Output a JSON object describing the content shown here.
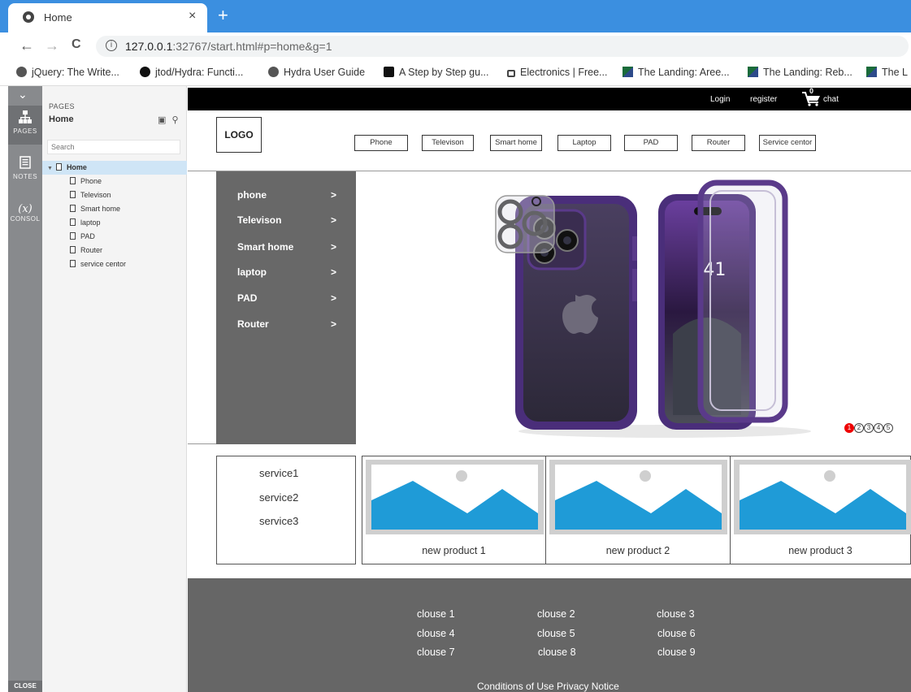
{
  "browser": {
    "tab_title": "Home",
    "tab_close": "×",
    "new_tab": "+",
    "back": "←",
    "forward": "→",
    "reload": "C",
    "url_host": "127.0.0.1",
    "url_rest": ":32767/start.html#p=home&g=1",
    "bookmarks": [
      {
        "label": "jQuery: The Write...",
        "icon": "globe-icon"
      },
      {
        "label": "jtod/Hydra: Functi...",
        "icon": "github-icon"
      },
      {
        "label": "Hydra User Guide",
        "icon": "globe-icon"
      },
      {
        "label": "A Step by Step gu...",
        "icon": "medium-icon"
      },
      {
        "label": "Electronics | Free...",
        "icon": "lock-icon"
      },
      {
        "label": "The Landing: Aree...",
        "icon": "flag-icon"
      },
      {
        "label": "The Landing: Reb...",
        "icon": "flag-icon"
      },
      {
        "label": "The L",
        "icon": "flag-icon"
      }
    ]
  },
  "sidebar": {
    "toggle": "⌄",
    "rail": {
      "pages": "PAGES",
      "notes": "NOTES",
      "console_symbol": "(x)",
      "console": "CONSOL",
      "close": "CLOSE"
    },
    "panel": {
      "heading": "PAGES",
      "current": "Home",
      "search_placeholder": "Search",
      "root": "Home",
      "pages": [
        "Phone",
        "Televison",
        "Smart home",
        "laptop",
        "PAD",
        "Router",
        "service centor"
      ]
    }
  },
  "site": {
    "top_links": {
      "login": "Login",
      "register": "register",
      "cart_count": "0",
      "chat": "chat"
    },
    "logo": "LOGO",
    "nav": [
      "Phone",
      "Televison",
      "Smart home",
      "Laptop",
      "PAD",
      "Router",
      "Service centor"
    ],
    "categories": [
      "phone",
      "Televison",
      "Smart home",
      "laptop",
      "PAD",
      "Router"
    ],
    "category_arrow": ">",
    "banner_clock": ":41",
    "slides": [
      "1",
      "2",
      "3",
      "4",
      "5"
    ],
    "services": [
      "service1",
      "service2",
      "service3"
    ],
    "products": [
      "new product 1",
      "new product 2",
      "new product 3"
    ],
    "clauses": [
      "clouse 1",
      "clouse 2",
      "clouse  3",
      "clouse 4",
      "clouse 5",
      "clouse 6",
      "clouse 7",
      "clouse 8",
      "clouse 9"
    ],
    "legal": "Conditions of Use Privacy Notice"
  },
  "colors": {
    "tabbar": "#3b8fe0",
    "sidebar_rail": "#888a8d",
    "category_menu": "#686868",
    "footer": "#666666",
    "placeholder_sky": "#1f9bd7",
    "active_dot": "#ee0000",
    "phone_purple": "#5a3a8a"
  }
}
